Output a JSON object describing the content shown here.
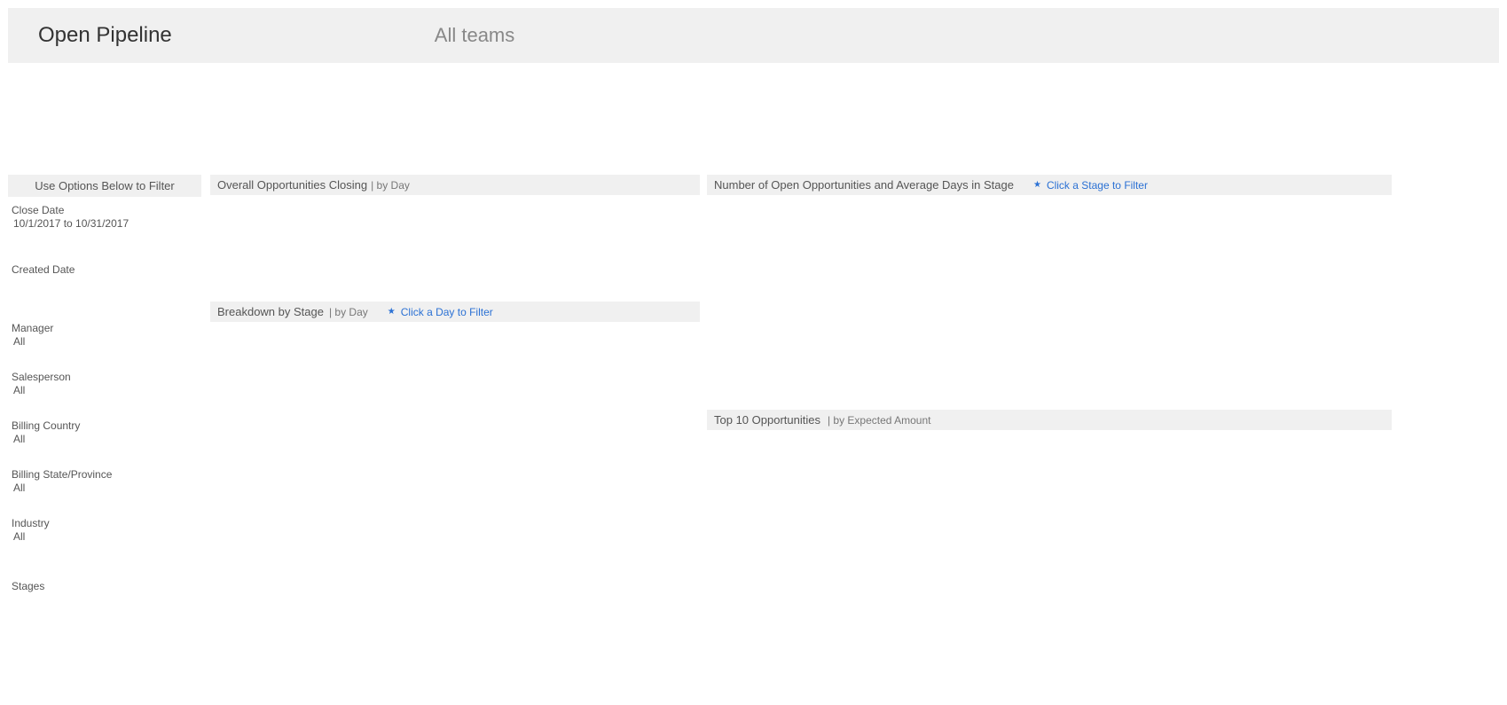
{
  "header": {
    "title": "Open Pipeline",
    "subtitle": "All teams"
  },
  "filters": {
    "header": "Use Options Below to Filter",
    "close_date": {
      "label": "Close Date",
      "value": "10/1/2017 to 10/31/2017"
    },
    "created_date": {
      "label": "Created Date"
    },
    "manager": {
      "label": "Manager",
      "value": "All"
    },
    "salesperson": {
      "label": "Salesperson",
      "value": "All"
    },
    "billing_country": {
      "label": "Billing Country",
      "value": "All"
    },
    "billing_state": {
      "label": "Billing State/Province",
      "value": "All"
    },
    "industry": {
      "label": "Industry",
      "value": "All"
    },
    "stages": {
      "label": "Stages"
    }
  },
  "panels": {
    "overall": {
      "title": "Overall Opportunities Closing",
      "sub": "| by Day"
    },
    "breakdown": {
      "title": "Breakdown by Stage",
      "sub": "| by Day",
      "hint": "Click a Day to Filter"
    },
    "open_opps": {
      "title": "Number of Open Opportunities and Average Days in Stage",
      "hint": "Click a Stage to Filter"
    },
    "top10": {
      "title": "Top 10 Opportunities",
      "sub": "| by Expected Amount"
    }
  }
}
